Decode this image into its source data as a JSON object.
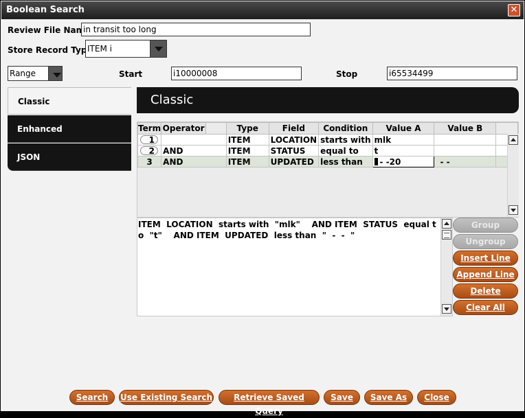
{
  "window": {
    "title": "Boolean Search",
    "close_glyph": "✕"
  },
  "form": {
    "review_file_label": "Review File Name:",
    "review_file_value": "in transit too long",
    "store_type_label": "Store Record Type:",
    "store_type_value": "ITEM  i",
    "range_value": "Range",
    "start_label": "Start",
    "start_value": "i10000008",
    "stop_label": "Stop",
    "stop_value": "i65534499"
  },
  "tabs": [
    {
      "label": "Classic",
      "active": true
    },
    {
      "label": "Enhanced",
      "active": false
    },
    {
      "label": "JSON",
      "active": false
    }
  ],
  "panel_title": "Classic",
  "grid": {
    "columns": [
      "Term",
      "Operator",
      "Type",
      "Field",
      "Condition",
      "Value A",
      "Value B"
    ],
    "rows": [
      {
        "term": "1",
        "operator": "",
        "type": "ITEM",
        "field": "LOCATION",
        "condition": "starts with",
        "value_a": "mlk",
        "value_b": ""
      },
      {
        "term": "2",
        "operator": "AND",
        "type": "ITEM",
        "field": "STATUS",
        "condition": "equal to",
        "value_a": "t",
        "value_b": ""
      },
      {
        "term": "3",
        "operator": "AND",
        "type": "ITEM",
        "field": "UPDATED",
        "condition": "less than",
        "value_a": "-   -20",
        "value_b": "-  -"
      }
    ]
  },
  "query_text": "ITEM  LOCATION  starts with  \"mlk\"    AND ITEM  STATUS  equal to  \"t\"    AND ITEM  UPDATED  less than  \"  -  -  \"",
  "side_buttons": {
    "group": "Group",
    "ungroup": "Ungroup",
    "insert_line": "Insert Line",
    "append_line": "Append Line",
    "delete": "Delete",
    "clear_all": "Clear All"
  },
  "bottom_buttons": {
    "search": "Search",
    "use_existing": "Use Existing Search",
    "retrieve_saved": "Retrieve Saved Query",
    "save": "Save",
    "save_as": "Save As",
    "close": "Close"
  },
  "colors": {
    "accent": "#c0601f",
    "dark": "#141414",
    "selected_row": "#dde5d9"
  }
}
